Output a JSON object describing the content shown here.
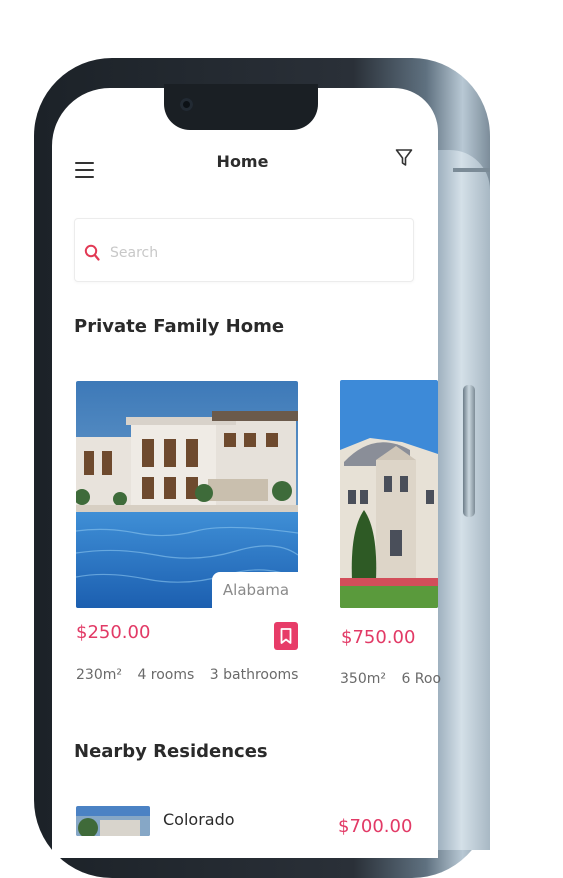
{
  "header": {
    "title": "Home"
  },
  "search": {
    "placeholder": "Search"
  },
  "sections": {
    "featured_title": "Private Family Home",
    "nearby_title": "Nearby Residences"
  },
  "featured": [
    {
      "location": "Alabama",
      "price": "$250.00",
      "area": "230m²",
      "rooms": "4 rooms",
      "bathrooms": "3 bathrooms"
    },
    {
      "price": "$750.00",
      "area": "350m²",
      "rooms": "6 Roo"
    }
  ],
  "nearby": [
    {
      "name": "Colorado",
      "price": "$700.00"
    }
  ],
  "colors": {
    "accent": "#e73c68",
    "price": "#e23a66",
    "phone_frame": "#1c2228"
  },
  "icons": [
    "menu-icon",
    "filter-icon",
    "search-icon",
    "bookmark-icon"
  ]
}
